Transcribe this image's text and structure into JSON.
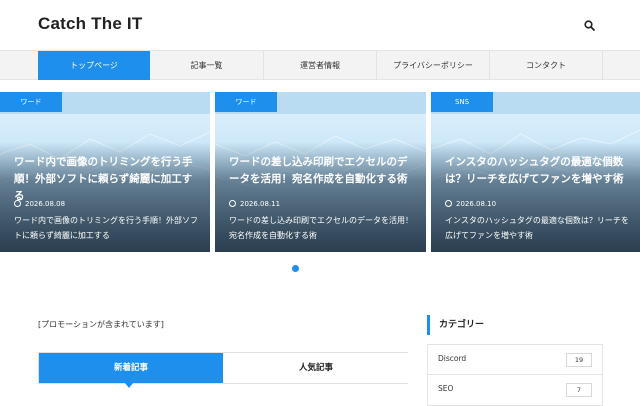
{
  "header": {
    "site_title": "Catch The IT",
    "search_icon": "search-icon"
  },
  "nav": {
    "items": [
      "トップページ",
      "記事一覧",
      "運営者情報",
      "プライバシーポリシー",
      "コンタクト"
    ],
    "active_index": 0
  },
  "slider": {
    "cards": [
      {
        "category": "ワード",
        "title": "ワード内で画像のトリミングを行う手順！外部ソフトに頼らず綺麗に加工する",
        "date": "2026.08.08",
        "excerpt": "ワード内で画像のトリミングを行う手順！外部ソフトに頼らず綺麗に加工する"
      },
      {
        "category": "ワード",
        "title": "ワードの差し込み印刷でエクセルのデータを活用！宛名作成を自動化する術",
        "date": "2026.08.11",
        "excerpt": "ワードの差し込み印刷でエクセルのデータを活用！宛名作成を自動化する術"
      },
      {
        "category": "SNS",
        "title": "インスタのハッシュタグの最適な個数は？リーチを広げてファンを増やす術",
        "date": "2026.08.10",
        "excerpt": "インスタのハッシュタグの最適な個数は？リーチを広げてファンを増やす術"
      }
    ]
  },
  "main": {
    "promo_notice": "[プロモーションが含まれています]",
    "tabs": [
      "新着記事",
      "人気記事"
    ],
    "active_tab": 0
  },
  "sidebar": {
    "heading": "カテゴリー",
    "categories": [
      {
        "name": "Discord",
        "count": "19"
      },
      {
        "name": "SEO",
        "count": "7"
      }
    ]
  },
  "colors": {
    "accent": "#1f8fee",
    "nav_bg": "#f3f3f3"
  }
}
